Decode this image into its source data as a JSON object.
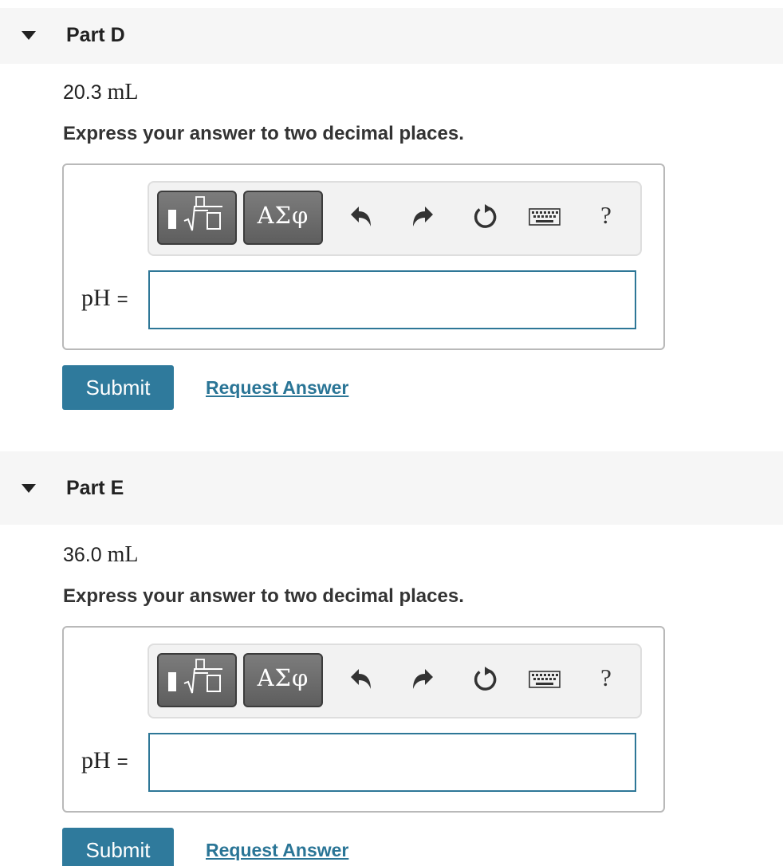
{
  "parts": [
    {
      "title": "Part D",
      "given_value": "20.3",
      "given_unit": "mL",
      "instruction": "Express your answer to two decimal places.",
      "toolbar": {
        "greek_label": "ΑΣφ",
        "help_label": "?"
      },
      "answer_label": "pH",
      "answer_equals": "=",
      "answer_value": "",
      "submit_label": "Submit",
      "request_label": "Request Answer"
    },
    {
      "title": "Part E",
      "given_value": "36.0",
      "given_unit": "mL",
      "instruction": "Express your answer to two decimal places.",
      "toolbar": {
        "greek_label": "ΑΣφ",
        "help_label": "?"
      },
      "answer_label": "pH",
      "answer_equals": "=",
      "answer_value": "",
      "submit_label": "Submit",
      "request_label": "Request Answer"
    }
  ],
  "colors": {
    "accent": "#2f7a9c",
    "input_border": "#2e7797",
    "header_bg": "#f6f6f6"
  },
  "icons": [
    "collapse-triangle-icon",
    "templates-icon",
    "undo-icon",
    "redo-icon",
    "reset-icon",
    "keyboard-icon",
    "help-icon"
  ]
}
